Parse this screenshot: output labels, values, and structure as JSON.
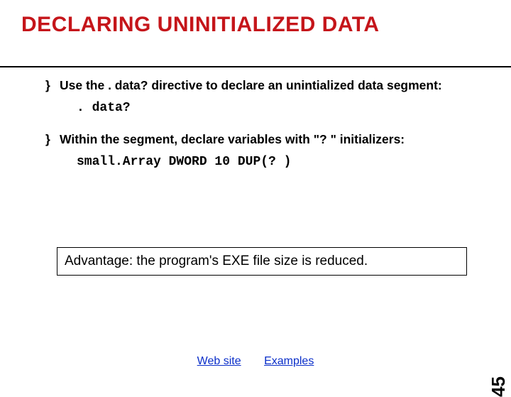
{
  "title": "DECLARING UNINITIALIZED DATA",
  "bullets": [
    {
      "text": "Use the . data? directive to declare an unintialized data segment:",
      "code": ". data?"
    },
    {
      "text": "Within the segment, declare variables with \"? \" initializers:",
      "code": "small.Array DWORD 10 DUP(? )"
    }
  ],
  "box": "Advantage: the program's EXE file size is reduced.",
  "links": {
    "website": "Web site",
    "examples": "Examples"
  },
  "page": "45"
}
